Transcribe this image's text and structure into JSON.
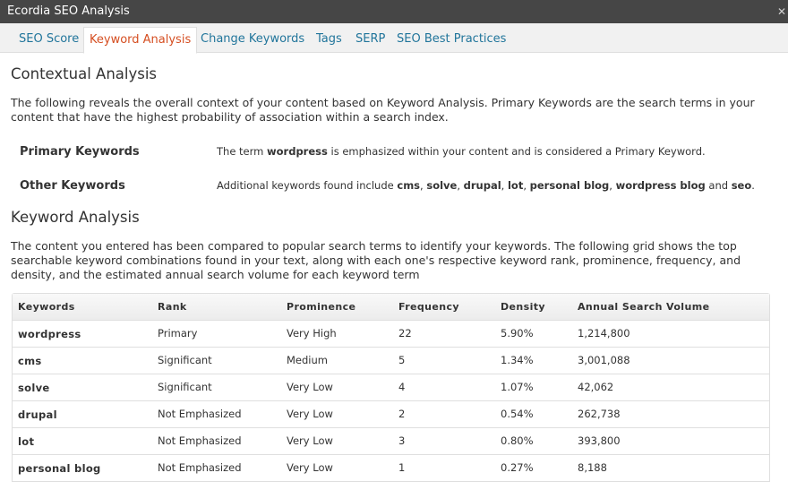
{
  "window": {
    "title": "Ecordia SEO Analysis"
  },
  "tabs": [
    {
      "label": "SEO Score"
    },
    {
      "label": "Keyword Analysis",
      "active": true
    },
    {
      "label": "Change Keywords"
    },
    {
      "label": "Tags"
    },
    {
      "label": "SERP"
    },
    {
      "label": "SEO Best Practices"
    }
  ],
  "contextual": {
    "heading": "Contextual Analysis",
    "description": "The following reveals the overall context of your content based on Keyword Analysis. Primary Keywords are the search terms in your content that have the highest probability of association within a search index.",
    "primary": {
      "label": "Primary Keywords",
      "text_before": "The term ",
      "term": "wordpress",
      "text_after": " is emphasized within your content and is considered a Primary Keyword."
    },
    "other": {
      "label": "Other Keywords",
      "text_before": "Additional keywords found include ",
      "terms": [
        "cms",
        "solve",
        "drupal",
        "lot",
        "personal blog",
        "wordpress blog"
      ],
      "conjunction": " and ",
      "last_term": "seo",
      "text_after": "."
    }
  },
  "keyword_analysis": {
    "heading": "Keyword Analysis",
    "description": "The content you entered has been compared to popular search terms to identify your keywords. The following grid shows the top searchable keyword combinations found in your text, along with each one's respective keyword rank, prominence, frequency, and density, and the estimated annual search volume for each keyword term",
    "columns": [
      "Keywords",
      "Rank",
      "Prominence",
      "Frequency",
      "Density",
      "Annual Search Volume"
    ],
    "rows": [
      [
        "wordpress",
        "Primary",
        "Very High",
        "22",
        "5.90%",
        "1,214,800"
      ],
      [
        "cms",
        "Significant",
        "Medium",
        "5",
        "1.34%",
        "3,001,088"
      ],
      [
        "solve",
        "Significant",
        "Very Low",
        "4",
        "1.07%",
        "42,062"
      ],
      [
        "drupal",
        "Not Emphasized",
        "Very Low",
        "2",
        "0.54%",
        "262,738"
      ],
      [
        "lot",
        "Not Emphasized",
        "Very Low",
        "3",
        "0.80%",
        "393,800"
      ],
      [
        "personal blog",
        "Not Emphasized",
        "Very Low",
        "1",
        "0.27%",
        "8,188"
      ]
    ]
  },
  "colors": {
    "link": "#21759b",
    "active_tab": "#d54e21",
    "titlebar": "#464646"
  }
}
